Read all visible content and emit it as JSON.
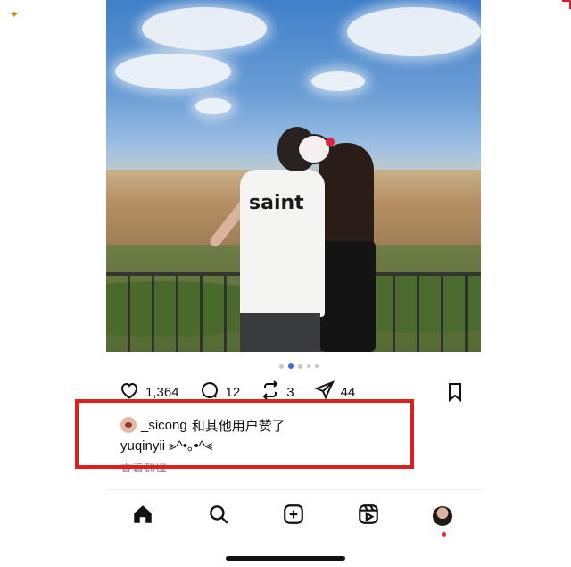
{
  "post": {
    "shirt_text": "saint",
    "carousel": {
      "count": 5,
      "active_index": 1
    }
  },
  "actions": {
    "like_count": "1,364",
    "comment_count": "12",
    "repost_count": "3",
    "share_count": "44"
  },
  "liked_by": {
    "username": "_sicong",
    "suffix": "和其他用户赞了"
  },
  "caption": {
    "text": "yuqinyii ⪢^•｡•^⪡"
  },
  "translate": {
    "label": "查看翻译"
  },
  "highlight_color": "#dc1f1f",
  "icons": {
    "like": "heart-icon",
    "comment": "comment-icon",
    "repost": "repost-icon",
    "share": "send-icon",
    "save": "bookmark-icon",
    "home": "home-icon",
    "search": "search-icon",
    "create": "add-post-icon",
    "reels": "reels-icon",
    "profile": "profile-avatar"
  }
}
